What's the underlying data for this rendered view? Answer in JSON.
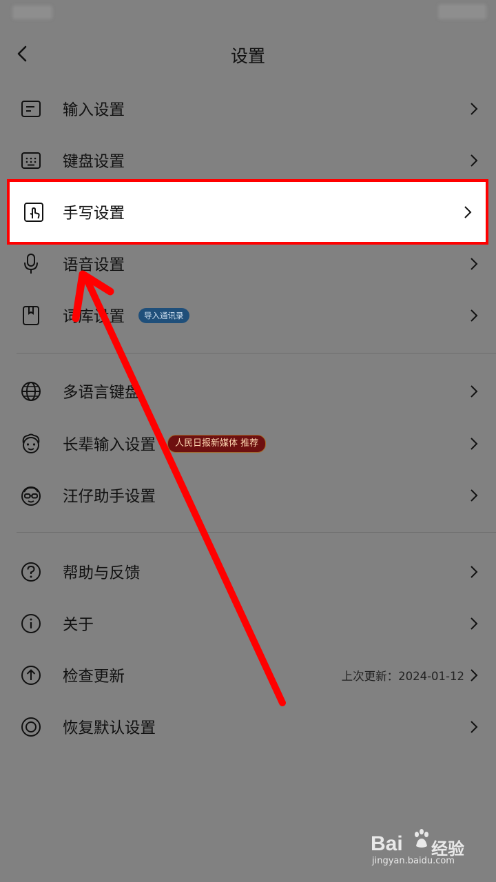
{
  "header": {
    "title": "设置"
  },
  "items": [
    {
      "label": "输入设置",
      "icon": "input-settings-icon"
    },
    {
      "label": "键盘设置",
      "icon": "keyboard-icon"
    },
    {
      "label": "手写设置",
      "icon": "handwriting-icon"
    },
    {
      "label": "语音设置",
      "icon": "microphone-icon"
    },
    {
      "label": "词库设置",
      "icon": "dictionary-icon",
      "badge": "导入通讯录"
    },
    {
      "label": "多语言键盘",
      "icon": "globe-icon"
    },
    {
      "label": "长辈输入设置",
      "icon": "elder-face-icon",
      "badge": "人民日报新媒体 推荐"
    },
    {
      "label": "汪仔助手设置",
      "icon": "assistant-face-icon"
    },
    {
      "label": "帮助与反馈",
      "icon": "help-icon"
    },
    {
      "label": "关于",
      "icon": "info-icon"
    },
    {
      "label": "检查更新",
      "icon": "update-icon",
      "meta": "上次更新：2024-01-12"
    },
    {
      "label": "恢复默认设置",
      "icon": "reset-icon"
    }
  ],
  "watermark": {
    "logo": "Bai",
    "cn": "经验",
    "url": "jingyan.baidu.com"
  },
  "colors": {
    "highlight": "#ff0000",
    "overlay": "#818181",
    "badge_blue": "#1f4f7a",
    "badge_red": "#6e1010"
  }
}
